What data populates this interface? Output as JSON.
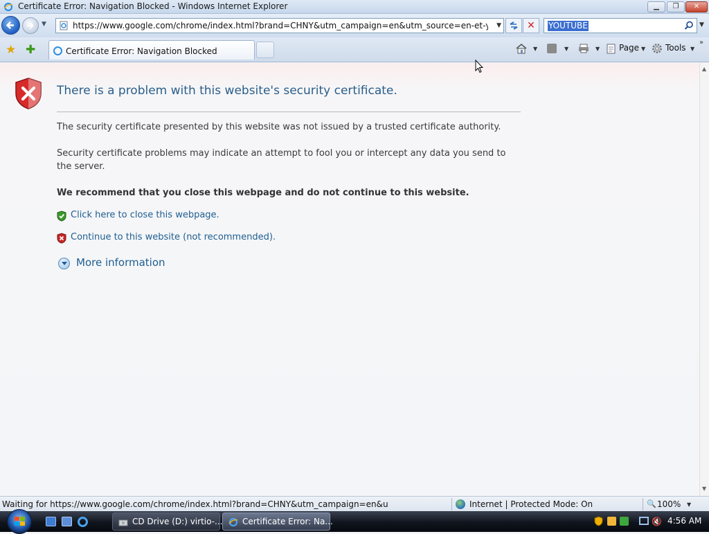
{
  "window": {
    "title": "Certificate Error: Navigation Blocked - Windows Internet Explorer",
    "min_label": "▁",
    "max_label": "❐",
    "close_label": "✕"
  },
  "nav": {
    "address": "https://www.google.com/chrome/index.html?brand=CHNY&utm_campaign=en&utm_source=en-et-youtube&u",
    "search_value": "YOUTUBE",
    "stop_label": "✕",
    "dropdown_glyph": "▼"
  },
  "tabs": {
    "active_label": "Certificate Error: Navigation Blocked",
    "more_glyph": "»"
  },
  "command_bar": {
    "page_label": "Page",
    "tools_label": "Tools",
    "dropdown_glyph": "▼"
  },
  "cert_page": {
    "title": "There is a problem with this website's security certificate.",
    "para1": "The security certificate presented by this website was not issued by a trusted certificate authority.",
    "para2": "Security certificate problems may indicate an attempt to fool you or intercept any data you send to the server.",
    "recommendation": "We recommend that you close this webpage and do not continue to this website.",
    "close_link": "Click here to close this webpage.",
    "continue_link": "Continue to this website (not recommended).",
    "more_info": "More information"
  },
  "status": {
    "text": "Waiting for https://www.google.com/chrome/index.html?brand=CHNY&utm_campaign=en&u",
    "zone": "Internet | Protected Mode: On",
    "zoom": "100%",
    "zoom_glyph": "🔍",
    "dropdown_glyph": "▼"
  },
  "taskbar": {
    "cd_label": "CD Drive (D:) virtio-...",
    "ie_label": "Certificate Error: Na...",
    "clock": "4:56 AM",
    "volume_glyph": "🔇"
  },
  "colors": {
    "link": "#1e5e8f",
    "title_blue": "#2a5e8a",
    "danger_red": "#c62828",
    "safe_green": "#3a9a2a"
  },
  "icons": [
    "internet-explorer-icon",
    "back-arrow-icon",
    "forward-arrow-icon",
    "page-icon",
    "refresh-icon",
    "stop-icon",
    "search-icon",
    "favorites-star-icon",
    "add-favorites-icon",
    "home-icon",
    "feeds-icon",
    "print-icon",
    "page-menu-icon",
    "tools-gear-icon",
    "red-shield-x-icon",
    "green-shield-check-icon",
    "globe-icon",
    "windows-start-orb",
    "cd-drive-icon"
  ]
}
